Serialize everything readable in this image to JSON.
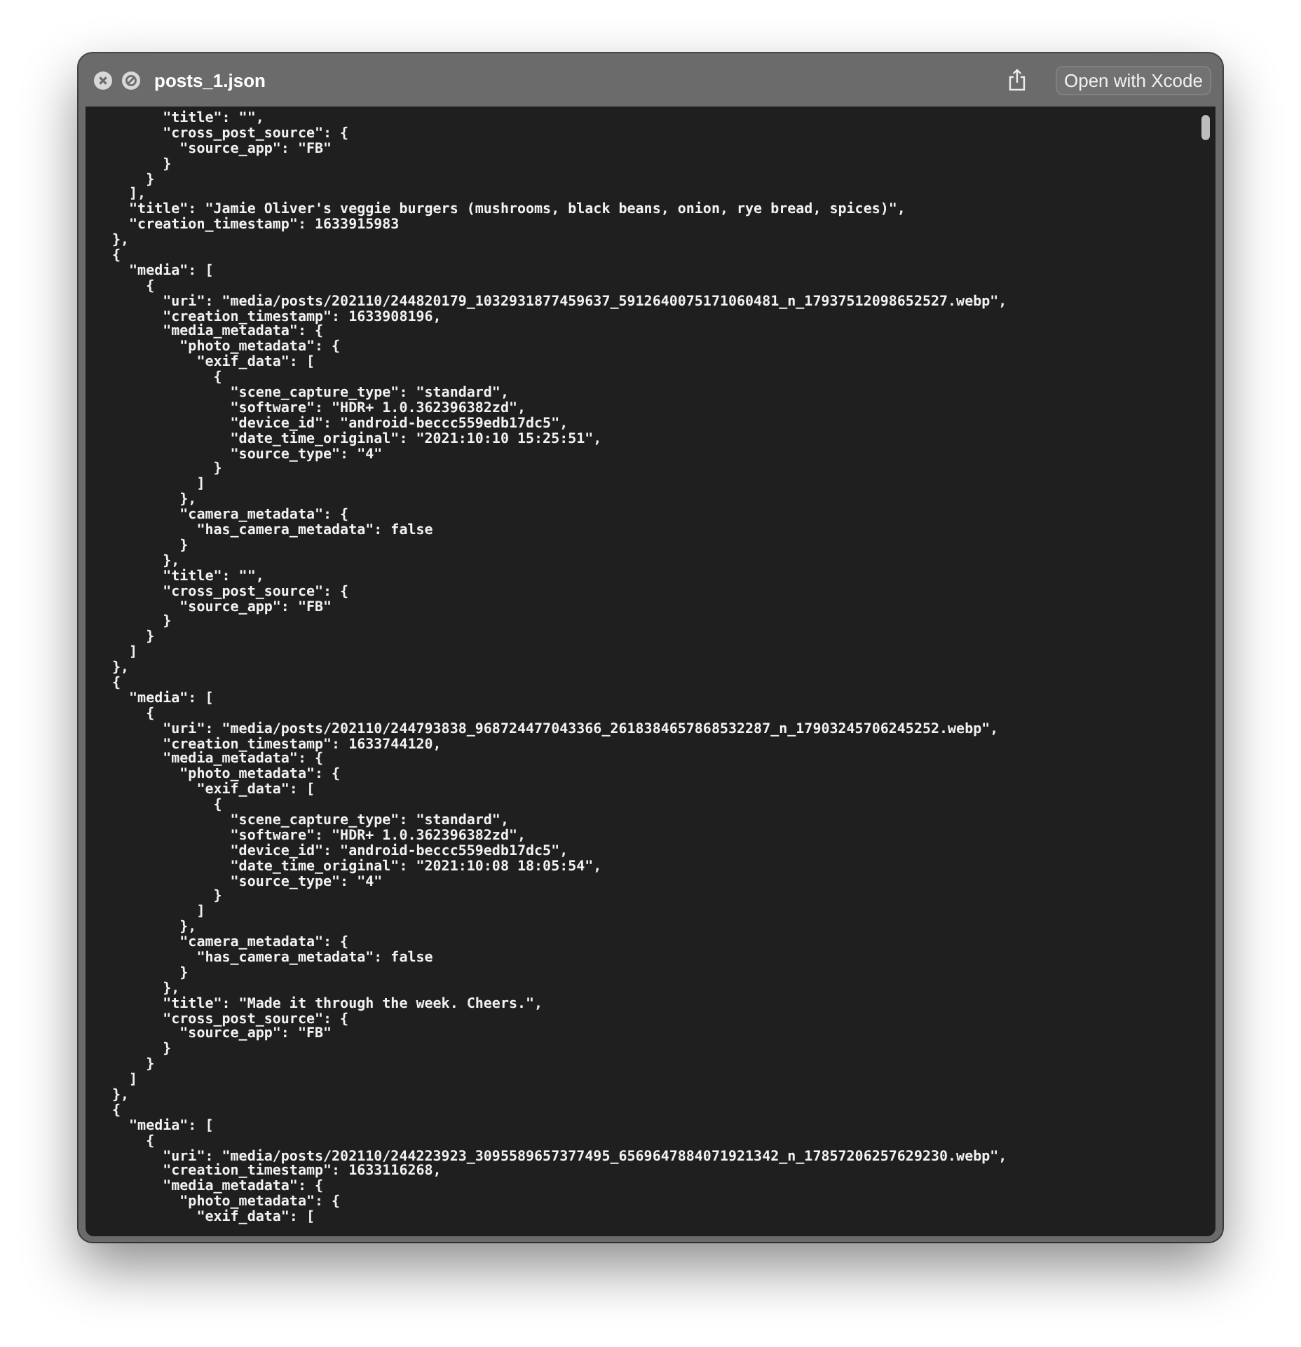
{
  "window": {
    "title": "posts_1.json",
    "open_button": "Open with Xcode"
  },
  "lines": [
    "      \"title\": \"\",",
    "      \"cross_post_source\": {",
    "        \"source_app\": \"FB\"",
    "      }",
    "    }",
    "  ],",
    "  \"title\": \"Jamie Oliver's veggie burgers (mushrooms, black beans, onion, rye bread, spices)\",",
    "  \"creation_timestamp\": 1633915983",
    "},",
    "{",
    "  \"media\": [",
    "    {",
    "      \"uri\": \"media/posts/202110/244820179_1032931877459637_5912640075171060481_n_17937512098652527.webp\",",
    "      \"creation_timestamp\": 1633908196,",
    "      \"media_metadata\": {",
    "        \"photo_metadata\": {",
    "          \"exif_data\": [",
    "            {",
    "              \"scene_capture_type\": \"standard\",",
    "              \"software\": \"HDR+ 1.0.362396382zd\",",
    "              \"device_id\": \"android-beccc559edb17dc5\",",
    "              \"date_time_original\": \"2021:10:10 15:25:51\",",
    "              \"source_type\": \"4\"",
    "            }",
    "          ]",
    "        },",
    "        \"camera_metadata\": {",
    "          \"has_camera_metadata\": false",
    "        }",
    "      },",
    "      \"title\": \"\",",
    "      \"cross_post_source\": {",
    "        \"source_app\": \"FB\"",
    "      }",
    "    }",
    "  ]",
    "},",
    "{",
    "  \"media\": [",
    "    {",
    "      \"uri\": \"media/posts/202110/244793838_968724477043366_2618384657868532287_n_17903245706245252.webp\",",
    "      \"creation_timestamp\": 1633744120,",
    "      \"media_metadata\": {",
    "        \"photo_metadata\": {",
    "          \"exif_data\": [",
    "            {",
    "              \"scene_capture_type\": \"standard\",",
    "              \"software\": \"HDR+ 1.0.362396382zd\",",
    "              \"device_id\": \"android-beccc559edb17dc5\",",
    "              \"date_time_original\": \"2021:10:08 18:05:54\",",
    "              \"source_type\": \"4\"",
    "            }",
    "          ]",
    "        },",
    "        \"camera_metadata\": {",
    "          \"has_camera_metadata\": false",
    "        }",
    "      },",
    "      \"title\": \"Made it through the week. Cheers.\",",
    "      \"cross_post_source\": {",
    "        \"source_app\": \"FB\"",
    "      }",
    "    }",
    "  ]",
    "},",
    "{",
    "  \"media\": [",
    "    {",
    "      \"uri\": \"media/posts/202110/244223923_3095589657377495_6569647884071921342_n_17857206257629230.webp\",",
    "      \"creation_timestamp\": 1633116268,",
    "      \"media_metadata\": {",
    "        \"photo_metadata\": {",
    "          \"exif_data\": ["
  ]
}
